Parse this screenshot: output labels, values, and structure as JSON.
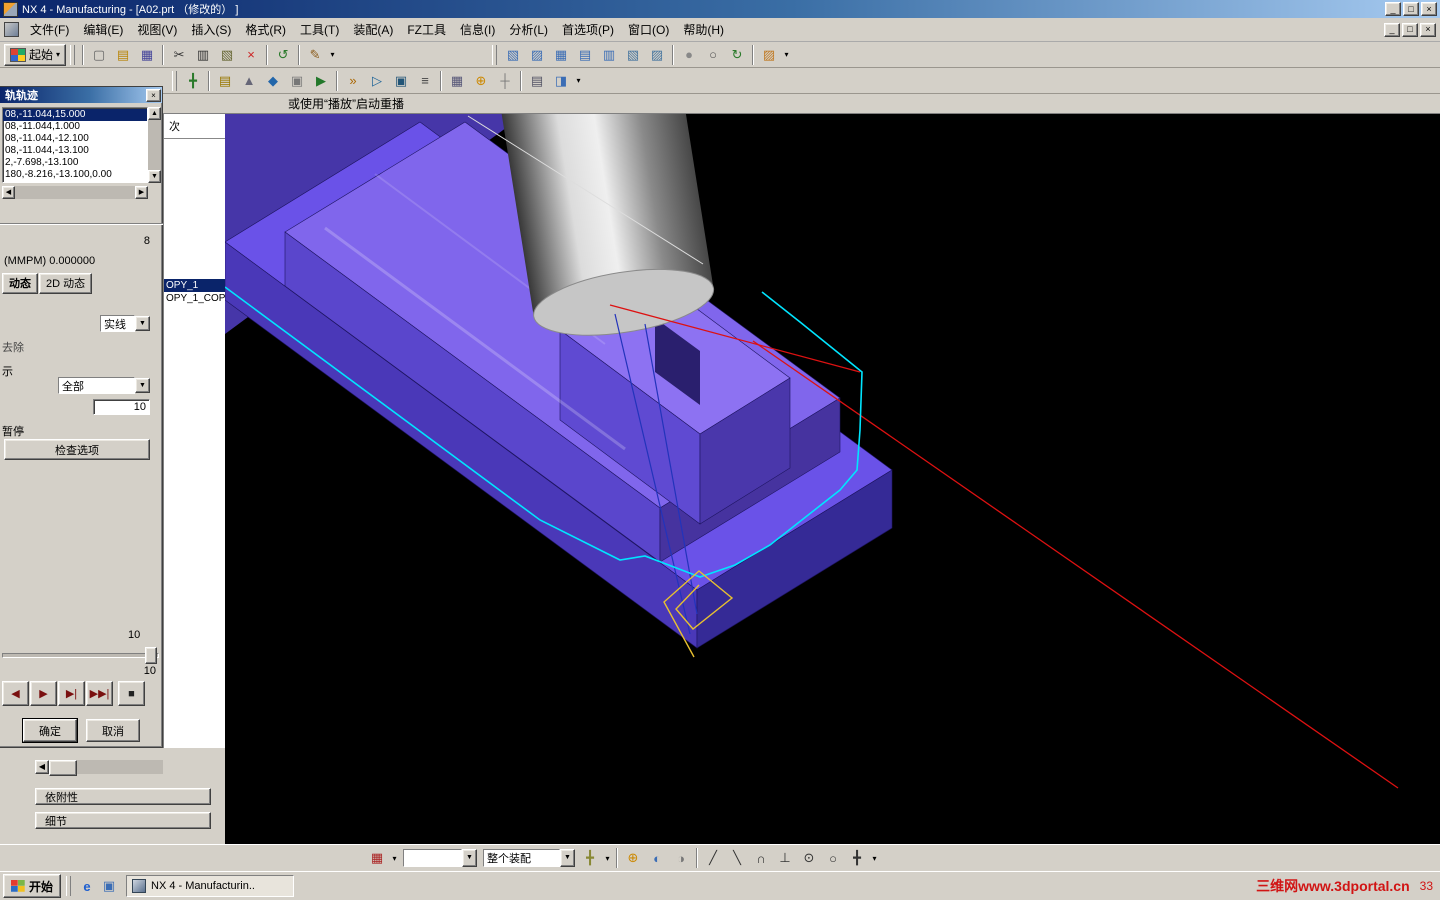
{
  "window": {
    "title": "NX 4 - Manufacturing - [A02.prt （修改的） ]",
    "buttons": {
      "min": "_",
      "max": "□",
      "close": "×"
    }
  },
  "menu": {
    "items": [
      "文件(F)",
      "编辑(E)",
      "视图(V)",
      "插入(S)",
      "格式(R)",
      "工具(T)",
      "装配(A)",
      "FZ工具",
      "信息(I)",
      "分析(L)",
      "首选项(P)",
      "窗口(O)",
      "帮助(H)"
    ]
  },
  "toolbar1": {
    "start_label": "起始",
    "caret": "▾",
    "icons": [
      {
        "cls": "tbgrip",
        "name": "toolbar-grip"
      },
      {
        "cls": "tbsep",
        "name": "separator"
      },
      {
        "cls": "tbicon",
        "name": "new-file-icon",
        "glyph": "▢",
        "color": "#666666"
      },
      {
        "cls": "tbicon",
        "name": "open-file-icon",
        "glyph": "▤",
        "color": "#b8860b"
      },
      {
        "cls": "tbicon",
        "name": "save-icon",
        "glyph": "▦",
        "color": "#44449a"
      },
      {
        "cls": "tbsep",
        "name": "separator"
      },
      {
        "cls": "tbicon",
        "name": "cut-icon",
        "glyph": "✂",
        "color": "#333333"
      },
      {
        "cls": "tbicon",
        "name": "copy-icon",
        "glyph": "▥",
        "color": "#333333"
      },
      {
        "cls": "tbicon",
        "name": "paste-icon",
        "glyph": "▧",
        "color": "#666633"
      },
      {
        "cls": "tbicon",
        "name": "delete-icon",
        "glyph": "×",
        "color": "#cc2222"
      },
      {
        "cls": "tbsep",
        "name": "separator"
      },
      {
        "cls": "tbicon",
        "name": "undo-icon",
        "glyph": "↺",
        "color": "#2a7a2a"
      },
      {
        "cls": "tbsep",
        "name": "separator"
      },
      {
        "cls": "tbicon",
        "name": "sketch-icon",
        "glyph": "✎",
        "color": "#8a5a1a"
      },
      {
        "cls": "tbcaret",
        "name": "sketch-dropdown-caret",
        "glyph": "▾"
      },
      {
        "cls": "tbgap",
        "name": "toolbar-gap"
      },
      {
        "cls": "tbgrip",
        "name": "toolbar-grip"
      },
      {
        "cls": "tbicon",
        "name": "view-trimetric-icon",
        "glyph": "▧",
        "color": "#3b6db5"
      },
      {
        "cls": "tbicon",
        "name": "view-isometric-icon",
        "glyph": "▨",
        "color": "#3b6db5"
      },
      {
        "cls": "tbicon",
        "name": "view-top-icon",
        "glyph": "▦",
        "color": "#3b6db5"
      },
      {
        "cls": "tbicon",
        "name": "view-front-icon",
        "glyph": "▤",
        "color": "#3b6db5"
      },
      {
        "cls": "tbicon",
        "name": "view-right-icon",
        "glyph": "▥",
        "color": "#3b6db5"
      },
      {
        "cls": "tbicon",
        "name": "view-back-icon",
        "glyph": "▧",
        "color": "#46759f"
      },
      {
        "cls": "tbicon",
        "name": "view-bottom-icon",
        "glyph": "▨",
        "color": "#46759f"
      },
      {
        "cls": "tbsep",
        "name": "separator"
      },
      {
        "cls": "tbicon",
        "name": "shaded-display-icon",
        "glyph": "●",
        "color": "#888888"
      },
      {
        "cls": "tbicon",
        "name": "wireframe-display-icon",
        "glyph": "○",
        "color": "#555555"
      },
      {
        "cls": "tbicon",
        "name": "rotate-view-icon",
        "glyph": "↻",
        "color": "#2a7a2a"
      },
      {
        "cls": "tbsep",
        "name": "separator"
      },
      {
        "cls": "tbicon",
        "name": "material-display-icon",
        "glyph": "▨",
        "color": "#c07820"
      },
      {
        "cls": "tbcaret",
        "name": "view-dropdown-caret",
        "glyph": "▾"
      }
    ]
  },
  "toolbar2": {
    "icons": [
      {
        "cls": "tbgrip",
        "name": "toolbar-grip"
      },
      {
        "cls": "tbicon",
        "name": "snap-point-icon",
        "glyph": "╋",
        "color": "#2a7a2a"
      },
      {
        "cls": "tbsep",
        "name": "separator"
      },
      {
        "cls": "tbicon",
        "name": "create-program-icon",
        "glyph": "▤",
        "color": "#997700"
      },
      {
        "cls": "tbicon",
        "name": "create-tool-icon",
        "glyph": "▲",
        "color": "#666677"
      },
      {
        "cls": "tbicon",
        "name": "create-geometry-icon",
        "glyph": "◆",
        "color": "#2266aa"
      },
      {
        "cls": "tbicon",
        "name": "create-method-icon",
        "glyph": "▣",
        "color": "#777777"
      },
      {
        "cls": "tbicon",
        "name": "create-operation-icon",
        "glyph": "▶",
        "color": "#22772a"
      },
      {
        "cls": "tbsep",
        "name": "separator"
      },
      {
        "cls": "tbicon",
        "name": "generate-toolpath-icon",
        "glyph": "»",
        "color": "#aa6600"
      },
      {
        "cls": "tbicon",
        "name": "replay-toolpath-icon",
        "glyph": "▷",
        "color": "#226699"
      },
      {
        "cls": "tbicon",
        "name": "verify-toolpath-icon",
        "glyph": "▣",
        "color": "#225577"
      },
      {
        "cls": "tbicon",
        "name": "list-toolpath-icon",
        "glyph": "≡",
        "color": "#444444"
      },
      {
        "cls": "tbsep",
        "name": "separator"
      },
      {
        "cls": "tbicon",
        "name": "machine-tool-icon",
        "glyph": "▦",
        "color": "#555577"
      },
      {
        "cls": "tbicon",
        "name": "wcs-icon",
        "glyph": "⊕",
        "color": "#cc8800"
      },
      {
        "cls": "tbicon",
        "name": "datum-plane-icon",
        "glyph": "┼",
        "color": "#777777"
      },
      {
        "cls": "tbsep",
        "name": "separator"
      },
      {
        "cls": "tbicon",
        "name": "layer-settings-icon",
        "glyph": "▤",
        "color": "#555566"
      },
      {
        "cls": "tbicon",
        "name": "orient-view-icon",
        "glyph": "◨",
        "color": "#3b6db5"
      },
      {
        "cls": "tbcaret",
        "name": "toolbar-dropdown-caret",
        "glyph": "▾"
      }
    ]
  },
  "message_bar": {
    "text": "或使用“播放”启动重播"
  },
  "replay_dialog": {
    "title": "轨轨迹",
    "close_glyph": "×",
    "points": [
      {
        "text": "08,-11.044,15.000",
        "selected": true
      },
      {
        "text": "08,-11.044,1.000"
      },
      {
        "text": "08,-11.044,-12.100"
      },
      {
        "text": "08,-11.044,-13.100"
      },
      {
        "text": "2,-7.698,-13.100"
      },
      {
        "text": "180,-8.216,-13.100,0.00"
      }
    ],
    "count_label": "8",
    "feed_label": "(MMPM) 0.000000",
    "tabs": [
      {
        "label": "动态",
        "selected": true
      },
      {
        "label": "2D 动态"
      }
    ],
    "line_style_value": "实线",
    "remove_label": "去除",
    "show_label": "示",
    "filter_value": "全部",
    "number_value": "10",
    "pause_label": "暂停",
    "check_options_label": "检查选项",
    "slider_top_label": "10",
    "slider_bottom_label": "10",
    "playback": [
      {
        "name": "play-reverse-button",
        "glyph": "◀",
        "color": "#7a1010"
      },
      {
        "name": "play-forward-button",
        "glyph": "▶",
        "color": "#7a1010"
      },
      {
        "name": "step-forward-button",
        "glyph": "▶|",
        "color": "#7a1010"
      },
      {
        "name": "fast-forward-button",
        "glyph": "▶▶|",
        "color": "#7a1010"
      },
      {
        "name": "stop-button",
        "glyph": "■",
        "color": "#222222"
      }
    ],
    "ok_label": "确定",
    "cancel_label": "取消"
  },
  "navigator": {
    "header": "次",
    "items": [
      {
        "label": "OPY_1",
        "selected": true
      },
      {
        "label": "OPY_1_COP"
      }
    ]
  },
  "left_panel": {
    "sections": [
      "依附性",
      "细节"
    ]
  },
  "bottom_toolbar": {
    "filter_combo_value": "",
    "assembly_combo_value": "整个装配",
    "icons_left": [
      {
        "cls": "tbicon",
        "name": "selection-filter-icon",
        "glyph": "▦",
        "color": "#aa2222"
      },
      {
        "cls": "tbcaret",
        "name": "selection-filter-caret",
        "glyph": "▾"
      }
    ],
    "icons_right": [
      {
        "cls": "tbicon",
        "name": "snap-settings-icon",
        "glyph": "╋",
        "color": "#888833"
      },
      {
        "cls": "tbcaret",
        "name": "snap-settings-caret",
        "glyph": "▾"
      },
      {
        "cls": "tbsep",
        "name": "separator"
      },
      {
        "cls": "tbicon",
        "name": "point-constructor-icon",
        "glyph": "⊕",
        "color": "#cc8800"
      },
      {
        "cls": "tbicon",
        "name": "plane-constructor-icon",
        "glyph": "◐",
        "color": "#3b6db5"
      },
      {
        "cls": "tbicon",
        "name": "vector-constructor-icon",
        "glyph": "◑",
        "color": "#777777"
      },
      {
        "cls": "tbsep",
        "name": "separator"
      },
      {
        "cls": "tbicon",
        "name": "snap-end-point-icon",
        "glyph": "╱",
        "color": "#333333"
      },
      {
        "cls": "tbicon",
        "name": "snap-mid-point-icon",
        "glyph": "╲",
        "color": "#333333"
      },
      {
        "cls": "tbicon",
        "name": "snap-arc-icon",
        "glyph": "∩",
        "color": "#333333"
      },
      {
        "cls": "tbicon",
        "name": "snap-intersection-icon",
        "glyph": "⊥",
        "color": "#333333"
      },
      {
        "cls": "tbicon",
        "name": "snap-center-icon",
        "glyph": "⊙",
        "color": "#333333"
      },
      {
        "cls": "tbicon",
        "name": "snap-circle-icon",
        "glyph": "○",
        "color": "#333333"
      },
      {
        "cls": "tbicon",
        "name": "snap-point2-icon",
        "glyph": "╋",
        "color": "#333333"
      },
      {
        "cls": "tbcaret",
        "name": "snap-caret",
        "glyph": "▾"
      }
    ]
  },
  "taskbar": {
    "start_label": "开始",
    "quick_launch": [
      {
        "name": "internet-explorer-icon",
        "glyph": "e",
        "color": "#1e5fd0"
      },
      {
        "name": "desktop-icon",
        "glyph": "▣",
        "color": "#3b6db5"
      }
    ],
    "task_label": "NX 4 - Manufacturin..",
    "watermark": "三维网www.3dportal.cn",
    "clock": "33"
  },
  "viewport": {
    "bg": "#000000",
    "part": {
      "backdrop": "#4636a8",
      "base_top": "#6a52e8",
      "base_front": "#4a38b8",
      "base_right": "#352a96",
      "plat_top": "#8066ec",
      "plat_front": "#5a46cc",
      "plat_right": "#46339f",
      "boss_top": "#8d72f2",
      "boss_front": "#5f4ad2",
      "boss_right": "#4a37ab",
      "notch": "#2a1f6e"
    },
    "paths": {
      "cyan": "#00e5ff",
      "red": "#dd1111",
      "yellow": "#e8c030",
      "navy": "#2233bb",
      "white": "#dddddd"
    }
  }
}
